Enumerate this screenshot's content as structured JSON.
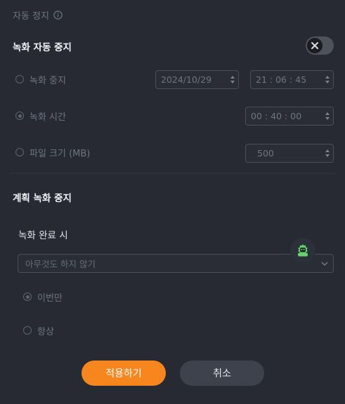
{
  "auto_stop": {
    "section_label": "자동 정지"
  },
  "record_auto_stop": {
    "title": "녹화 자동 중지",
    "options": [
      {
        "label": "녹화 중지",
        "date": "2024/10/29",
        "time": "21 : 06 : 45"
      },
      {
        "label": "녹화 시간",
        "duration": "00 : 40 : 00"
      },
      {
        "label": "파일 크기 (MB)",
        "size": "500"
      }
    ],
    "selected_index": 1
  },
  "scheduled_stop": {
    "title": "계획 녹화 중지",
    "on_complete_label": "녹화 완료 시",
    "action_value": "아무것도 하지 않기",
    "scope_options": [
      "이번만",
      "항상"
    ],
    "scope_selected_index": 0
  },
  "buttons": {
    "apply": "적용하기",
    "cancel": "취소"
  },
  "colors": {
    "accent": "#f7861f",
    "background": "#272a33",
    "assistant_icon": "#66d36e"
  },
  "icons": {
    "info": "info-icon",
    "toggle_off": "close-icon",
    "assistant": "assistant-robot-icon",
    "dropdown": "chevron-down-icon"
  }
}
